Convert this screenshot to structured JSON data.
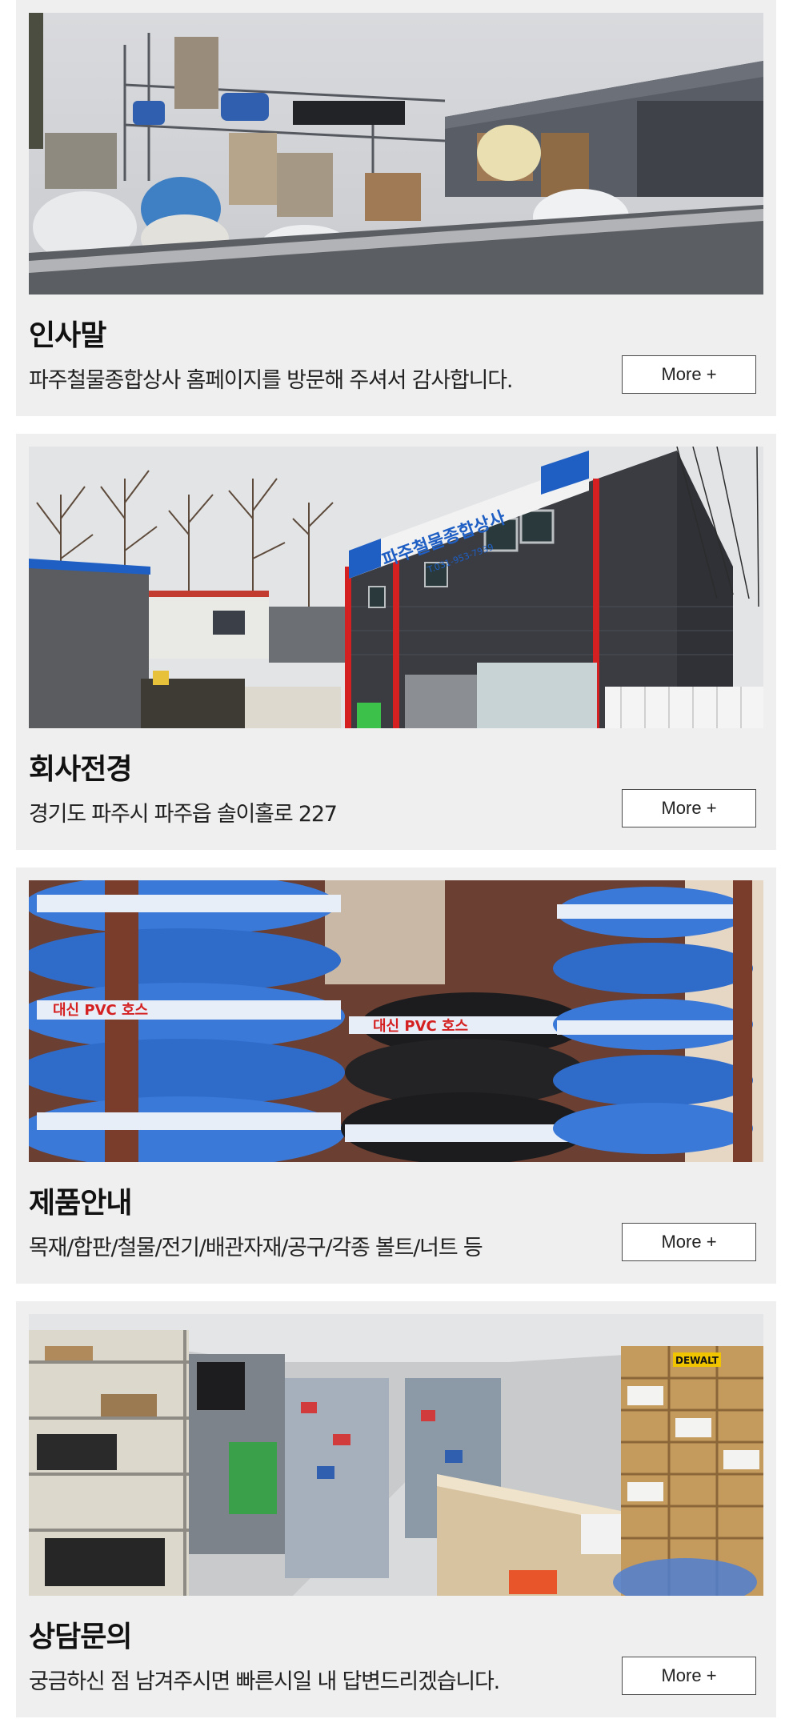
{
  "cards": [
    {
      "title": "인사말",
      "description": "파주철물종합상사 홈페이지를 방문해 주셔서 감사합니다.",
      "more_label": "More +",
      "photo": "outdoor-yard-photo"
    },
    {
      "title": "회사전경",
      "description": "경기도 파주시 파주읍 솔이홀로 227",
      "more_label": "More +",
      "photo": "building-exterior-photo",
      "sign": {
        "main": "파주철물종합상사",
        "phone": "T.031-953-7939"
      }
    },
    {
      "title": "제품안내",
      "description": "목재/합판/철물/전기/배관자재/공구/각종 볼트/너트 등",
      "more_label": "More +",
      "photo": "pvc-hose-rolls-photo",
      "hose_label": "대신 PVC 호스"
    },
    {
      "title": "상담문의",
      "description": "궁금하신 점 남겨주시면 빠른시일 내 답변드리겠습니다.",
      "more_label": "More +",
      "photo": "store-interior-photo",
      "brand_sign": "DEWALT"
    }
  ],
  "colors": {
    "card_background": "#efefef",
    "button_border": "#4a4a4a",
    "sign_blue": "#1f5fc4",
    "sign_red": "#d42020",
    "hose_blue": "#3a79d8"
  }
}
